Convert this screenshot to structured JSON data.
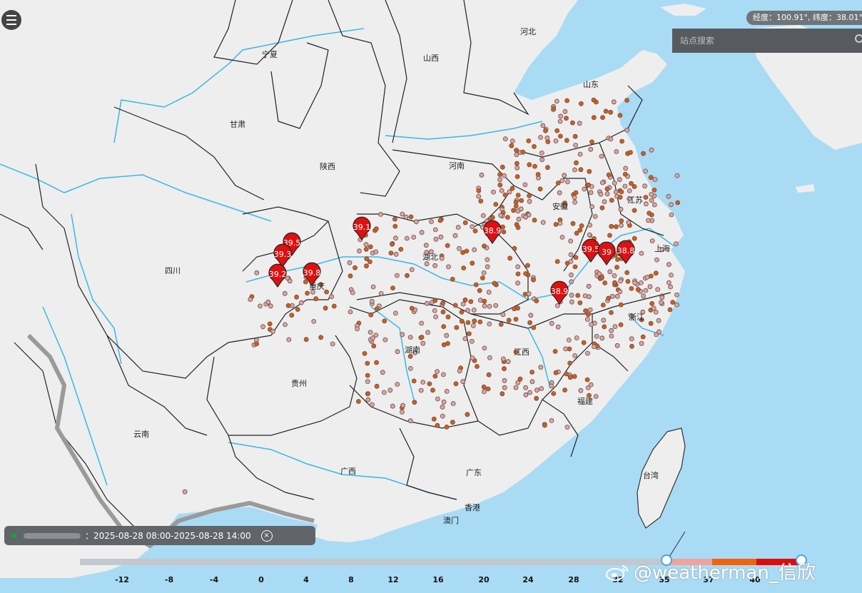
{
  "map": {
    "provinces": [
      {
        "name": "宁夏"
      },
      {
        "name": "山西"
      },
      {
        "name": "河北"
      },
      {
        "name": "山东"
      },
      {
        "name": "甘肃"
      },
      {
        "name": "陕西"
      },
      {
        "name": "河南"
      },
      {
        "name": "江苏"
      },
      {
        "name": "安徽"
      },
      {
        "name": "湖北"
      },
      {
        "name": "上海"
      },
      {
        "name": "四川"
      },
      {
        "name": "重庆"
      },
      {
        "name": "浙江"
      },
      {
        "name": "湖南"
      },
      {
        "name": "江西"
      },
      {
        "name": "贵州"
      },
      {
        "name": "福建"
      },
      {
        "name": "云南"
      },
      {
        "name": "台湾"
      },
      {
        "name": "广西"
      },
      {
        "name": "广东"
      },
      {
        "name": "香港"
      },
      {
        "name": "澳门"
      }
    ],
    "markers": [
      {
        "value": "39.1"
      },
      {
        "value": "39.5"
      },
      {
        "value": "39.3"
      },
      {
        "value": "39.2"
      },
      {
        "value": "39.8"
      },
      {
        "value": "38.9"
      },
      {
        "value": "39.5"
      },
      {
        "value": "39"
      },
      {
        "value": "38.8"
      },
      {
        "value": "38.9"
      }
    ],
    "colors": {
      "sea": "#a9dbf5",
      "land": "#eeeeee",
      "river": "#38b8e6",
      "light_dot": "#e8a09a",
      "dark_dot": "#dd5a10",
      "marker": "#dd1111"
    }
  },
  "ui": {
    "menu_icon": "hamburger-menu-icon",
    "coord_text": "经度：100.91°, 纬度：38.01°",
    "search_placeholder": "站点搜索",
    "search_icon": "search-icon",
    "time_range": "2025-08-28 08:00-2025-08-28 14:00",
    "time_prefix": "：",
    "close_icon": "close-icon"
  },
  "legend": {
    "ticks": [
      "-12",
      "-8",
      "-4",
      "0",
      "4",
      "8",
      "12",
      "16",
      "20",
      "24",
      "28",
      "32",
      "35",
      "37",
      "40"
    ],
    "segments": [
      {
        "from": "35",
        "to": "37",
        "color": "#f0a39b"
      },
      {
        "from": "37",
        "to": "40",
        "color": "#f0620c"
      },
      {
        "from": "40",
        "to": "",
        "color": "#e00c0c"
      }
    ]
  },
  "watermark": "@weatherman_信欣"
}
